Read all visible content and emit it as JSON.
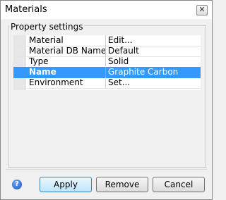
{
  "window": {
    "title": "Materials",
    "close_glyph": "✕"
  },
  "group": {
    "label": "Property settings"
  },
  "properties": [
    {
      "name": "Material",
      "value": "Edit..."
    },
    {
      "name": "Material DB Name",
      "value": "Default"
    },
    {
      "name": "Type",
      "value": "Solid"
    },
    {
      "name": "Name",
      "value": "Graphite Carbon",
      "selected": true
    },
    {
      "name": "Environment",
      "value": "Set..."
    }
  ],
  "buttons": {
    "apply": "Apply",
    "remove": "Remove",
    "cancel": "Cancel"
  },
  "help": {
    "glyph": "?"
  },
  "colors": {
    "selection": "#3399ff"
  }
}
